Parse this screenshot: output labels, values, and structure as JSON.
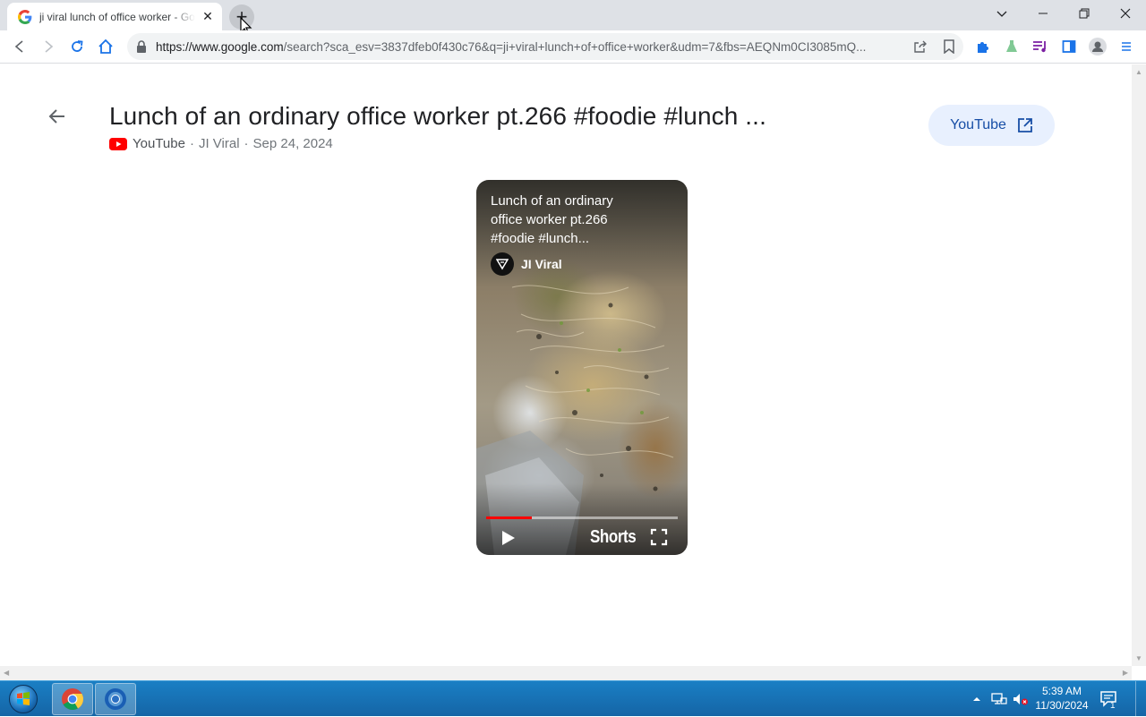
{
  "browser": {
    "tab_title": "ji viral lunch of office worker - Go",
    "url_host": "https://www.google.com",
    "url_rest": "/search?sca_esv=3837dfeb0f430c76&q=ji+viral+lunch+of+office+worker&udm=7&fbs=AEQNm0CI3085mQ...",
    "new_tab_symbol": "+",
    "close_symbol": "✕"
  },
  "result": {
    "title": "Lunch of an ordinary office worker pt.266 #foodie #lunch ...",
    "source": "YouTube",
    "channel": "JI Viral",
    "date": "Sep 24, 2024",
    "separator": "·",
    "open_button_label": "YouTube"
  },
  "video": {
    "title": "Lunch of an ordinary office worker pt.266 #foodie #lunch...",
    "channel": "JI Viral",
    "shorts_label": "Shorts",
    "progress": 0.24
  },
  "taskbar": {
    "time": "5:39 AM",
    "date": "11/30/2024",
    "notification_count": "1"
  },
  "colors": {
    "youtube_red": "#ff0000",
    "link_blue": "#174ea6",
    "chip_bg": "#e8f0fe"
  }
}
